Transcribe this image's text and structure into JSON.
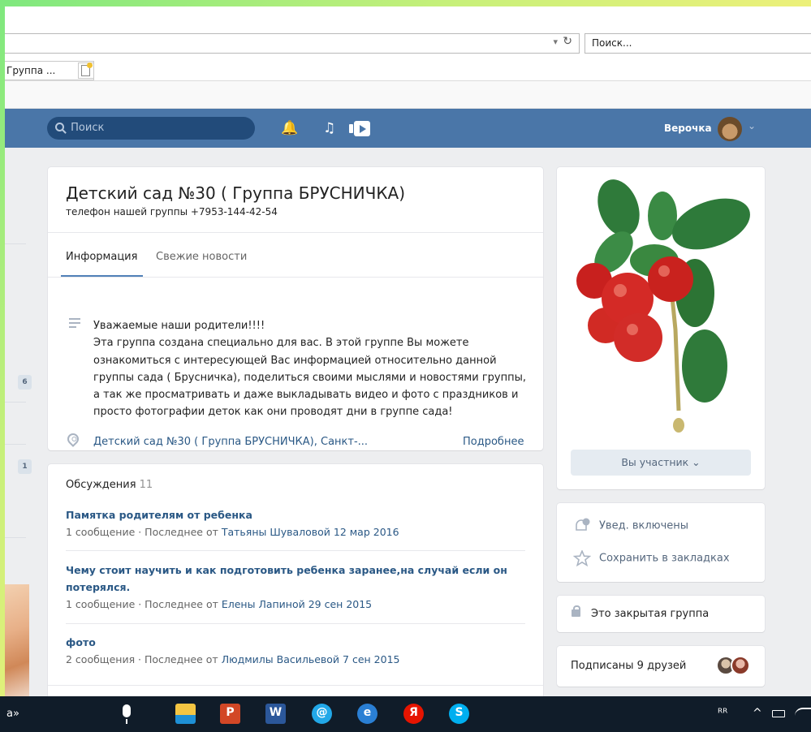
{
  "browser": {
    "search_placeholder": "Поиск...",
    "tab_title": "Группа ...",
    "tab_close": "×",
    "addr_dropdown": "▾",
    "addr_refresh": "↻"
  },
  "header": {
    "search_placeholder": "Поиск",
    "user_name": "Верочка",
    "chevron": "⌄",
    "bell": "🔔",
    "music": "♫"
  },
  "sidebar": {
    "counters": [
      "6",
      "1"
    ]
  },
  "group": {
    "title": "Детский сад №30 ( Группа БРУСНИЧКА)",
    "status": "телефон нашей группы +7953-144-42-54",
    "tabs": [
      {
        "label": "Информация"
      },
      {
        "label": "Свежие новости"
      }
    ],
    "description_lines": [
      "Уважаемые наши родители!!!!",
      "Эта группа создана специально для вас. В этой группе Вы можете",
      "ознакомиться с интересующей Вас информацией относительно данной",
      "группы сада ( Брусничка), поделиться своими мыслями и новостями группы,",
      "а так же просматривать и даже выкладывать видео и фото с праздников и",
      "просто фотографии деток как они проводят дни в группе сада!"
    ],
    "address": "Детский сад №30 ( Группа БРУСНИЧКА), Санкт-...",
    "more": "Подробнее"
  },
  "discussions": {
    "title": "Обсуждения",
    "count": "11",
    "topics": [
      {
        "title_lines": [
          "Памятка родителям от ребенка"
        ],
        "meta": "1 сообщение · Последнее от ",
        "author": "Татьяны Шуваловой 12 мар 2016"
      },
      {
        "title_lines": [
          "Чему стоит научить и как подготовить ребенка заранее,на случай если он",
          "потерялся."
        ],
        "meta": "1 сообщение · Последнее от ",
        "author": "Елены Лапиной 29 сен 2015"
      },
      {
        "title_lines": [
          "фото"
        ],
        "meta": "2 сообщения · Последнее от ",
        "author": "Людмилы Васильевой 7 сен 2015"
      }
    ]
  },
  "right": {
    "member_button": "Вы участник ⌄",
    "notifications": "Увед. включены",
    "bookmarks": "Сохранить в закладках",
    "closed_group": "Это закрытая группа",
    "friends": "Подписаны 9 друзей"
  },
  "taskbar": {
    "search_text": "а»",
    "apps": [
      {
        "name": "file-explorer",
        "letter": ""
      },
      {
        "name": "powerpoint",
        "letter": "P"
      },
      {
        "name": "word",
        "letter": "W"
      },
      {
        "name": "mail",
        "letter": "@"
      },
      {
        "name": "internet-explorer",
        "letter": "e"
      },
      {
        "name": "yandex-browser",
        "letter": "Я"
      },
      {
        "name": "skype",
        "letter": "S"
      }
    ],
    "tray_people": "ᴿᴿ",
    "tray_arrow": "^"
  },
  "colors": {
    "vk_header": "#4a76a8",
    "link": "#2a5885",
    "page_bg": "#edeef0",
    "taskbar": "#101c29"
  }
}
